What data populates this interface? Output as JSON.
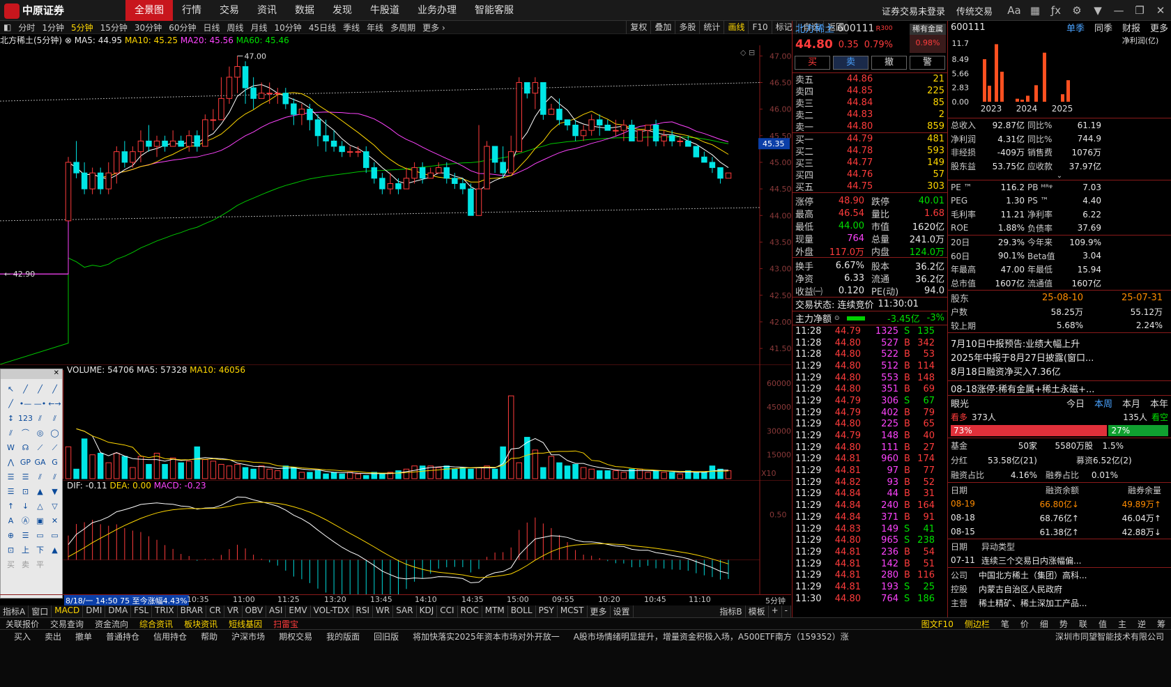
{
  "app": {
    "logo_text": "中原证券",
    "nav": [
      "全景图",
      "行情",
      "交易",
      "资讯",
      "数据",
      "发现",
      "牛股道",
      "业务办理",
      "智能客服"
    ],
    "login": "证券交易未登录",
    "trade": "传统交易"
  },
  "periods": [
    "分时",
    "1分钟",
    "5分钟",
    "15分钟",
    "30分钟",
    "60分钟",
    "日线",
    "周线",
    "月线",
    "10分钟",
    "45日线",
    "季线",
    "年线",
    "多周期",
    "更多 ›"
  ],
  "tools": [
    "复权",
    "叠加",
    "多股",
    "统计",
    "画线",
    "F10",
    "标记",
    "-自选",
    "返回"
  ],
  "ma": {
    "name": "北方稀土(5分钟)",
    "ma5": "MA5: 44.95",
    "ma10": "MA10: 45.25",
    "ma20": "MA20: 45.56",
    "ma60": "MA60: 45.46"
  },
  "chart_data": [
    {
      "type": "candlestick",
      "title": "北方稀土(5分钟)",
      "ylim": [
        41.2,
        47.2
      ],
      "yticks": [
        "47.00",
        "46.50",
        "46.00",
        "45.50",
        "45.00",
        "44.50",
        "44.00",
        "43.50",
        "43.00",
        "42.50",
        "42.00",
        "41.50"
      ],
      "annotations": {
        "high": "47.00",
        "low": "42.90",
        "current": "45.35"
      },
      "candles": [
        [
          43.9,
          45.0,
          45.1,
          43.9
        ],
        [
          45.0,
          44.8,
          45.4,
          44.7
        ],
        [
          44.8,
          44.5,
          45.0,
          44.4
        ],
        [
          44.5,
          44.8,
          44.9,
          44.4
        ],
        [
          44.8,
          44.5,
          44.9,
          44.4
        ],
        [
          44.5,
          44.8,
          45.0,
          44.4
        ],
        [
          44.8,
          45.2,
          45.3,
          44.6
        ],
        [
          45.2,
          45.0,
          45.4,
          44.9
        ],
        [
          45.0,
          45.2,
          45.3,
          44.9
        ],
        [
          45.2,
          45.4,
          45.6,
          45.0
        ],
        [
          45.4,
          45.3,
          45.7,
          45.2
        ],
        [
          45.3,
          45.4,
          45.5,
          45.1
        ],
        [
          45.4,
          45.3,
          45.5,
          45.2
        ],
        [
          45.3,
          45.4,
          45.6,
          45.3
        ],
        [
          45.4,
          45.3,
          45.5,
          45.3
        ],
        [
          45.3,
          45.5,
          45.6,
          45.2
        ],
        [
          45.5,
          45.3,
          45.6,
          45.2
        ],
        [
          45.3,
          45.8,
          45.9,
          45.3
        ],
        [
          45.8,
          45.8,
          46.0,
          45.6
        ],
        [
          45.8,
          46.2,
          46.6,
          45.8
        ],
        [
          46.2,
          46.6,
          46.8,
          46.1
        ],
        [
          46.6,
          46.8,
          47.0,
          46.3
        ],
        [
          46.8,
          46.4,
          46.9,
          46.1
        ],
        [
          46.4,
          46.2,
          46.6,
          46.0
        ],
        [
          46.2,
          46.3,
          46.5,
          46.2
        ],
        [
          46.3,
          46.3,
          46.5,
          46.1
        ],
        [
          46.3,
          46.3,
          46.4,
          46.1
        ],
        [
          46.3,
          46.1,
          46.4,
          46.0
        ],
        [
          46.1,
          45.9,
          46.2,
          45.7
        ],
        [
          45.9,
          46.0,
          46.1,
          45.7
        ],
        [
          46.0,
          45.8,
          46.1,
          45.6
        ],
        [
          45.8,
          45.5,
          45.9,
          45.3
        ],
        [
          45.5,
          45.4,
          45.8,
          45.2
        ],
        [
          45.4,
          45.3,
          45.6,
          45.2
        ],
        [
          45.3,
          45.2,
          45.4,
          45.1
        ],
        [
          45.2,
          45.2,
          45.3,
          45.1
        ],
        [
          45.2,
          45.2,
          45.3,
          45.1
        ],
        [
          45.2,
          44.9,
          45.3,
          44.8
        ],
        [
          44.9,
          44.7,
          45.0,
          44.6
        ],
        [
          44.7,
          44.5,
          44.8,
          44.4
        ],
        [
          44.5,
          44.6,
          44.8,
          44.4
        ],
        [
          44.6,
          44.5,
          44.7,
          44.4
        ],
        [
          44.5,
          44.7,
          44.9,
          44.5
        ],
        [
          44.7,
          44.9,
          45.0,
          44.6
        ],
        [
          44.9,
          44.7,
          45.0,
          44.6
        ],
        [
          44.7,
          44.8,
          44.9,
          44.7
        ],
        [
          44.8,
          44.9,
          45.0,
          44.8
        ],
        [
          44.9,
          44.7,
          45.0,
          44.6
        ],
        [
          44.7,
          44.6,
          44.8,
          44.5
        ],
        [
          44.6,
          44.5,
          44.7,
          44.4
        ],
        [
          44.5,
          44.0,
          44.6,
          44.0
        ],
        [
          44.0,
          44.5,
          45.7,
          44.0
        ],
        [
          44.5,
          45.3,
          45.4,
          44.5
        ],
        [
          45.3,
          45.0,
          45.3,
          44.8
        ],
        [
          45.0,
          44.8,
          45.3,
          44.7
        ],
        [
          44.8,
          45.2,
          45.5,
          44.8
        ],
        [
          45.2,
          46.5,
          46.6,
          45.2
        ],
        [
          46.5,
          46.3,
          46.5,
          46.2
        ],
        [
          46.3,
          46.5,
          46.6,
          46.0
        ],
        [
          46.5,
          45.9,
          46.5,
          45.8
        ],
        [
          45.9,
          46.0,
          46.1,
          45.9
        ],
        [
          46.0,
          45.8,
          46.2,
          45.7
        ],
        [
          45.8,
          45.7,
          45.8,
          45.6
        ],
        [
          45.7,
          45.5,
          45.8,
          45.4
        ],
        [
          45.5,
          45.6,
          45.7,
          45.4
        ],
        [
          45.6,
          45.8,
          45.9,
          45.5
        ],
        [
          45.8,
          45.7,
          45.9,
          45.5
        ],
        [
          45.7,
          45.6,
          45.8,
          45.6
        ],
        [
          45.6,
          45.6,
          45.8,
          45.5
        ],
        [
          45.6,
          45.7,
          45.8,
          45.4
        ],
        [
          45.7,
          45.4,
          45.8,
          45.4
        ],
        [
          45.4,
          45.6,
          45.6,
          45.4
        ],
        [
          45.6,
          45.7,
          45.7,
          45.3
        ],
        [
          45.7,
          45.4,
          45.8,
          45.3
        ],
        [
          45.4,
          45.5,
          45.6,
          45.3
        ],
        [
          45.5,
          45.4,
          45.6,
          45.3
        ],
        [
          45.4,
          45.4,
          45.5,
          45.3
        ],
        [
          45.4,
          45.3,
          45.5,
          45.3
        ],
        [
          45.3,
          45.1,
          45.3,
          45.1
        ],
        [
          45.1,
          45.0,
          45.2,
          45.0
        ],
        [
          45.0,
          44.9,
          45.1,
          44.8
        ],
        [
          44.9,
          44.7,
          44.9,
          44.6
        ],
        [
          44.7,
          44.8,
          44.8,
          44.7
        ]
      ]
    },
    {
      "type": "bar",
      "title": "VOLUME",
      "label": "VOLUME: 54706",
      "ma5": "MA5: 57328",
      "ma10": "MA10: 46056",
      "yticks": [
        "60000",
        "45000",
        "30000",
        "15000"
      ],
      "ylim": [
        0,
        70000
      ],
      "multiplier": "X10",
      "values": [
        68000,
        20000,
        6000,
        25000,
        15000,
        16000,
        10000,
        16000,
        14000,
        7000,
        14000,
        9000,
        16000,
        9000,
        13000,
        10000,
        11000,
        20000,
        12000,
        11000,
        9000,
        8000,
        9000,
        7000,
        6000,
        8000,
        6000,
        5000,
        8000,
        7000,
        4000,
        4000,
        5000,
        3000,
        4000,
        3000,
        4000,
        3000,
        2000,
        4000,
        3000,
        4000,
        5000,
        6000,
        8000,
        8000,
        8000,
        7000,
        8000,
        6000,
        7000,
        6000,
        7000,
        8000,
        6000,
        20000,
        52000,
        10000,
        26000,
        18000,
        7000,
        14000,
        10000,
        8000,
        9000,
        7000,
        6000,
        5000,
        5000,
        5000,
        4000,
        6000,
        6000,
        4000,
        5000,
        4000,
        4000,
        3000,
        5000,
        4000,
        4000,
        8000,
        6000,
        5000
      ]
    },
    {
      "type": "bar",
      "title": "MACD",
      "label_dif": "DIF: -0.11",
      "label_dea": "DEA: 0.00",
      "label_macd": "MACD: -0.23",
      "yticks": [
        "0.50"
      ],
      "ylim": [
        -0.35,
        0.85
      ]
    }
  ],
  "timeaxis": {
    "cursor": "8/18/一 14:50 75 至今涨幅4.43%",
    "labels": [
      "10:35",
      "11:00",
      "11:25",
      "13:20",
      "13:45",
      "14:10",
      "14:35",
      "15:00",
      "09:55",
      "10:20",
      "10:45",
      "11:10"
    ],
    "period": "5分钟"
  },
  "indicators": [
    "指标A",
    "窗口",
    "MACD",
    "DMI",
    "DMA",
    "FSL",
    "TRIX",
    "BRAR",
    "CR",
    "VR",
    "OBV",
    "ASI",
    "EMV",
    "VOL-TDX",
    "RSI",
    "WR",
    "SAR",
    "KDJ",
    "CCI",
    "ROC",
    "MTM",
    "BOLL",
    "PSY",
    "MCST",
    "更多",
    "设置"
  ],
  "indicators_right": [
    "指标B",
    "模板",
    "+",
    "-"
  ],
  "drawtools": [
    "↖",
    "╱",
    "╱",
    "╱",
    "╱",
    "•—",
    "—•",
    "←→",
    "↕",
    "123",
    "⫽",
    "⫽",
    "⫽",
    "⌒",
    "◎",
    "◯",
    "W",
    "☊",
    "⟋",
    "⟋",
    "⋀",
    "GP",
    "GA",
    "G",
    "☰",
    "☰",
    "⫽",
    "⫽",
    "☰",
    "⊡",
    "▲",
    "▼",
    "↑",
    "↓",
    "△",
    "▽",
    "A",
    "Ⓐ",
    "▣",
    "✕",
    "⊕",
    "☰",
    "▭",
    "▭",
    "⊡",
    "上",
    "下",
    "▲",
    "买",
    "卖",
    "平"
  ],
  "stock": {
    "name": "北方稀土",
    "code": "600111",
    "tag": "R",
    "tag2": "300",
    "sector": "稀有金属",
    "sector_pct": "0.98%",
    "price": "44.80",
    "chg": "0.35",
    "pct": "0.79%"
  },
  "trade_buttons": [
    "买",
    "卖",
    "撤",
    "警"
  ],
  "asks": [
    {
      "l": "卖五",
      "p": "44.86",
      "v": "21"
    },
    {
      "l": "卖四",
      "p": "44.85",
      "v": "225"
    },
    {
      "l": "卖三",
      "p": "44.84",
      "v": "85"
    },
    {
      "l": "卖二",
      "p": "44.83",
      "v": "2"
    },
    {
      "l": "卖一",
      "p": "44.80",
      "v": "859"
    }
  ],
  "bids": [
    {
      "l": "买一",
      "p": "44.79",
      "v": "481"
    },
    {
      "l": "买二",
      "p": "44.78",
      "v": "593"
    },
    {
      "l": "买三",
      "p": "44.77",
      "v": "149"
    },
    {
      "l": "买四",
      "p": "44.76",
      "v": "57"
    },
    {
      "l": "买五",
      "p": "44.75",
      "v": "303"
    }
  ],
  "stats": [
    [
      "涨停",
      "48.90",
      "跌停",
      "40.01"
    ],
    [
      "最高",
      "46.54",
      "量比",
      "1.68"
    ],
    [
      "最低",
      "44.00",
      "市值",
      "1620亿"
    ],
    [
      "现量",
      "764",
      "总量",
      "241.0万"
    ],
    [
      "外盘",
      "117.0万",
      "内盘",
      "124.0万"
    ]
  ],
  "stats2": [
    [
      "换手",
      "6.67%",
      "股本",
      "36.2亿"
    ],
    [
      "净资",
      "6.33",
      "流通",
      "36.2亿"
    ],
    [
      "收益㈠",
      "0.120",
      "PE(动)",
      "94.0"
    ]
  ],
  "trade_status": {
    "label": "交易状态: 连续竞价",
    "time": "11:30:01"
  },
  "main_flow": {
    "label": "主力净额",
    "value": "-3.45亿",
    "pct": "-3%"
  },
  "ticks": [
    [
      "11:28",
      "44.79",
      "1325",
      "S",
      "135"
    ],
    [
      "11:28",
      "44.80",
      "527",
      "B",
      "342"
    ],
    [
      "11:28",
      "44.80",
      "522",
      "B",
      "53"
    ],
    [
      "11:29",
      "44.80",
      "512",
      "B",
      "114"
    ],
    [
      "11:29",
      "44.80",
      "553",
      "B",
      "148"
    ],
    [
      "11:29",
      "44.80",
      "351",
      "B",
      "69"
    ],
    [
      "11:29",
      "44.79",
      "306",
      "S",
      "67"
    ],
    [
      "11:29",
      "44.79",
      "402",
      "B",
      "79"
    ],
    [
      "11:29",
      "44.80",
      "225",
      "B",
      "65"
    ],
    [
      "11:29",
      "44.79",
      "148",
      "B",
      "40"
    ],
    [
      "11:29",
      "44.80",
      "111",
      "B",
      "27"
    ],
    [
      "11:29",
      "44.81",
      "960",
      "B",
      "174"
    ],
    [
      "11:29",
      "44.81",
      "97",
      "B",
      "77"
    ],
    [
      "11:29",
      "44.82",
      "93",
      "B",
      "52"
    ],
    [
      "11:29",
      "44.84",
      "44",
      "B",
      "31"
    ],
    [
      "11:29",
      "44.84",
      "240",
      "B",
      "164"
    ],
    [
      "11:29",
      "44.84",
      "371",
      "B",
      "91"
    ],
    [
      "11:29",
      "44.83",
      "149",
      "S",
      "41"
    ],
    [
      "11:29",
      "44.80",
      "965",
      "S",
      "238"
    ],
    [
      "11:29",
      "44.81",
      "236",
      "B",
      "54"
    ],
    [
      "11:29",
      "44.81",
      "142",
      "B",
      "51"
    ],
    [
      "11:29",
      "44.81",
      "280",
      "B",
      "116"
    ],
    [
      "11:29",
      "44.81",
      "193",
      "S",
      "25"
    ],
    [
      "11:30",
      "44.80",
      "764",
      "S",
      "186"
    ]
  ],
  "fin": {
    "code": "600111",
    "tabs": [
      "单季",
      "同季",
      "财报",
      "更多"
    ],
    "chart_title": "净利润(亿)",
    "yticks": [
      "11.7",
      "8.49",
      "5.66",
      "2.83",
      "0.00"
    ],
    "years": [
      "2023",
      "2024",
      "2025"
    ],
    "bars": [
      8.5,
      3.2,
      11.5,
      6.0,
      0.6,
      0.4,
      1.2,
      3.3,
      9.8,
      1.5,
      4.3
    ]
  },
  "fund": [
    [
      "总收入",
      "92.87亿",
      "同比%",
      "61.19"
    ],
    [
      "净利润",
      "4.31亿",
      "同比%",
      "744.9"
    ],
    [
      "非经损",
      "-409万",
      "销售费",
      "1076万"
    ],
    [
      "股东益",
      "53.75亿",
      "应收款",
      "37.97亿"
    ]
  ],
  "ratio": [
    [
      "PE ™",
      "116.2",
      "PB ᴹᴿᵠ",
      "7.03"
    ],
    [
      "PEG",
      "1.30",
      "PS ™",
      "4.40"
    ],
    [
      "毛利率",
      "11.21",
      "净利率",
      "6.22"
    ],
    [
      "ROE",
      "1.88%",
      "负债率",
      "37.69"
    ]
  ],
  "perf": [
    [
      "20日",
      "29.3%",
      "今年来",
      "109.9%"
    ],
    [
      "60日",
      "90.1%",
      "Beta值",
      "3.04"
    ],
    [
      "年最高",
      "47.00",
      "年最低",
      "15.94"
    ],
    [
      "总市值",
      "1607亿",
      "流通值",
      "1607亿"
    ]
  ],
  "holders": {
    "label": "股东",
    "d1": "25-08-10",
    "d2": "25-07-31",
    "rows": [
      [
        "户数",
        "58.25万",
        "55.12万"
      ],
      [
        "较上期",
        "5.68%",
        "2.24%"
      ]
    ]
  },
  "news": [
    "7月10日中报预告:业绩大幅上升",
    "2025年中报于8月27日披露(窗口...",
    "8月18日融资净买入7.36亿"
  ],
  "news2": "08-18涨停:稀有金属+稀土永磁+...",
  "eye": {
    "label": "眼光",
    "tabs": [
      "今日",
      "本周",
      "本月",
      "本年"
    ],
    "bull": "看多",
    "bull_n": "373人",
    "bear_n": "135人",
    "bear": "看空",
    "bull_pct": "73%",
    "bear_pct": "27%"
  },
  "fund2": [
    [
      "基金",
      "50家",
      "5580万股",
      "1.5%"
    ],
    [
      "分红",
      "53.58亿(21)",
      "募资",
      "6.52亿(2)"
    ],
    [
      "融资占比",
      "4.16%",
      "融券占比",
      "0.01%"
    ]
  ],
  "margin": {
    "h": [
      "日期",
      "融资余额",
      "融券余量"
    ],
    "rows": [
      [
        "08-19",
        "66.80亿↓",
        "49.89万↑"
      ],
      [
        "08-18",
        "68.76亿↑",
        "46.04万↑"
      ],
      [
        "08-15",
        "61.38亿↑",
        "42.88万↓"
      ]
    ]
  },
  "abn": {
    "h": [
      "日期",
      "异动类型"
    ],
    "row": [
      "07-11",
      "连续三个交易日内涨幅偏..."
    ]
  },
  "company": [
    [
      "公司",
      "中国北方稀土（集团）高科..."
    ],
    [
      "控股",
      "内蒙古自治区人民政府"
    ],
    [
      "主营",
      "稀土精矿、稀土深加工产品..."
    ]
  ],
  "bottom": {
    "left": [
      "关联报价",
      "交易查询",
      "资金流向",
      "综合资讯",
      "板块资讯",
      "短线基因",
      "扫雷宝"
    ],
    "right": [
      "图文F10",
      "侧边栏",
      "笔",
      "价",
      "细",
      "势",
      "联",
      "值",
      "主",
      "逆",
      "筹"
    ]
  },
  "status": {
    "items": [
      "买入",
      "卖出",
      "撤单",
      "普通持仓",
      "信用持仓",
      "帮助",
      "沪深市场",
      "期权交易",
      "我的版面",
      "回旧版"
    ],
    "ticker": "将加快落实2025年资本市场对外开放一",
    "ticker2": "A股市场情绪明显提升，增量资金积极入场，A500ETF南方（159352）涨",
    "corp": "深圳市同望智能技术有限公司"
  }
}
